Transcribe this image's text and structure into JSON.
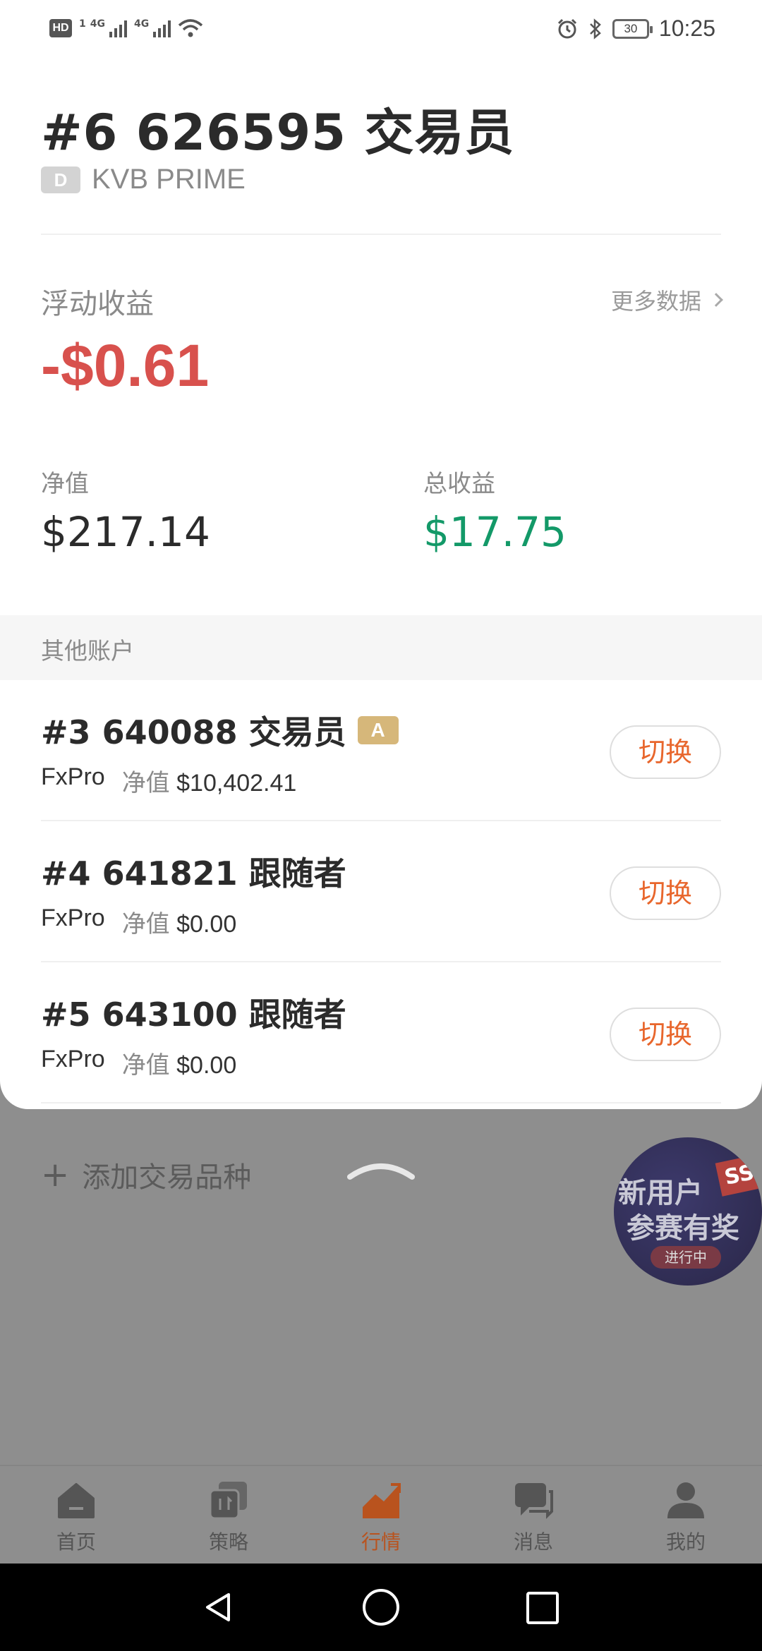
{
  "status_bar": {
    "hd_label": "HD",
    "sim_label": "1",
    "network_1": "4G",
    "network_2": "4G",
    "battery": "30",
    "time": "10:25"
  },
  "account": {
    "title": "#6 626595 交易员",
    "badge": "D",
    "broker": "KVB PRIME"
  },
  "floating": {
    "label": "浮动收益",
    "value": "-$0.61",
    "more_link": "更多数据"
  },
  "stats": {
    "nav_label": "净值",
    "nav_value": "$217.14",
    "total_label": "总收益",
    "total_value": "$17.75"
  },
  "other_accounts": {
    "header": "其他账户",
    "switch_label": "切换",
    "nav_key": "净值",
    "items": [
      {
        "name": "#3 640088 交易员",
        "badge": "A",
        "broker": "FxPro",
        "nav": "$10,402.41"
      },
      {
        "name": "#4 641821 跟随者",
        "badge": "",
        "broker": "FxPro",
        "nav": "$0.00"
      },
      {
        "name": "#5 643100 跟随者",
        "badge": "",
        "broker": "FxPro",
        "nav": "$0.00"
      }
    ]
  },
  "background": {
    "add_symbol": "添加交易品种",
    "promo_line1": "新用户",
    "promo_line2": "参赛有奖",
    "promo_status": "进行中",
    "promo_tag": "SS"
  },
  "tabs": [
    {
      "label": "首页",
      "icon": "home-icon"
    },
    {
      "label": "策略",
      "icon": "strategy-icon"
    },
    {
      "label": "行情",
      "icon": "market-icon",
      "active": true
    },
    {
      "label": "消息",
      "icon": "message-icon"
    },
    {
      "label": "我的",
      "icon": "profile-icon"
    }
  ],
  "colors": {
    "negative": "#d8514d",
    "positive": "#139968",
    "accent": "#e8662c"
  }
}
